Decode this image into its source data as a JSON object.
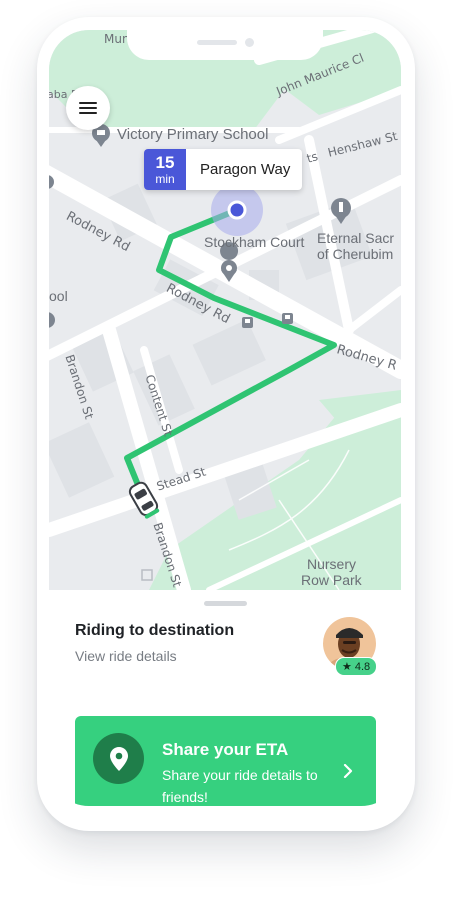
{
  "map": {
    "eta": {
      "minutes": "15",
      "unit": "min",
      "destination": "Paragon Way"
    },
    "labels": {
      "top_street": "Mun",
      "school": "Victory Primary School",
      "john_maurice": "John Maurice Cl",
      "henshaw": "Henshaw St",
      "rodney_rd_left": "Rodney Rd",
      "rodney_rd_mid": "Rodney Rd",
      "rodney_rd_right": "Rodney R",
      "stockham": "Stockham Court",
      "church_line1": "Eternal Sacr",
      "church_line2": "of Cherubim",
      "school_left": "ool",
      "brandon_top": "Brandon St",
      "content_st": "Content St",
      "stead_st": "Stead St",
      "brandon_bottom": "Brandon St",
      "park_line1": "Nursery",
      "park_line2": "Row Park",
      "aba": "aba R",
      "sts": "ts"
    },
    "colors": {
      "route": "#2fc472",
      "park": "#cdeed9",
      "road": "#ffffff",
      "block": "#eceef1"
    }
  },
  "ride": {
    "title": "Riding to destination",
    "subtitle": "View ride details",
    "driver_rating": "4.8"
  },
  "share": {
    "title": "Share your ETA",
    "description": "Share your ride details to friends!",
    "icon": "location-pin-icon"
  }
}
